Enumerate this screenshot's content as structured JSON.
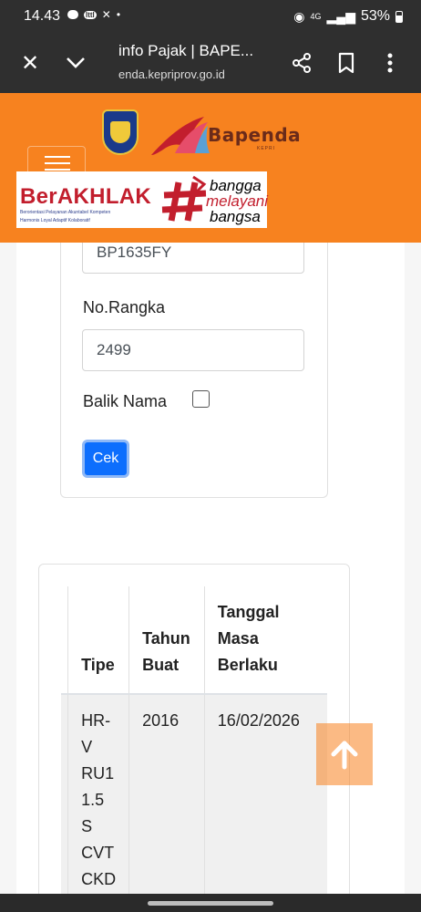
{
  "status_bar": {
    "time": "14.43",
    "notification_badge": "Ittl",
    "battery_percent": "53%",
    "network": "4G"
  },
  "browser": {
    "page_title": "info Pajak | BAPE...",
    "url": "enda.kepriprov.go.id"
  },
  "header": {
    "brand_name": "Bapenda",
    "brand_subtitle": "KEPRI",
    "campaign": {
      "title": "BerAKHLAK",
      "tagline_line1": "Berorientasi Pelayanan Akuntabel Kompeten",
      "tagline_line2": "Harmonis Loyal Adaptif Kolaboratif",
      "slogan_line1": "bangga",
      "slogan_line2": "melayani",
      "slogan_line3": "bangsa"
    }
  },
  "form": {
    "plate_value": "BP1635FY",
    "rangka_label": "No.Rangka",
    "rangka_value": "2499",
    "balik_nama_label": "Balik Nama",
    "balik_nama_checked": false,
    "submit_label": "Cek"
  },
  "result_table": {
    "headers": {
      "tipe_line1": "Tipe",
      "tahun_line1": "Tahun",
      "tahun_line2": "Buat",
      "tanggal_line1": "Tanggal",
      "tanggal_line2": "Masa",
      "tanggal_line3": "Berlaku"
    },
    "rows": [
      {
        "tipe_lines": [
          "HR-",
          "V",
          "RU1",
          "1.5",
          "S",
          "CVT",
          "CKD"
        ],
        "tahun": "2016",
        "tanggal": "16/02/2026"
      }
    ]
  },
  "colors": {
    "header_orange": "#f7821f",
    "button_blue": "#0d6efd",
    "berakhlak_red": "#c21e2d"
  },
  "icons": [
    "close-icon",
    "chevron-down-icon",
    "share-icon",
    "bookmark-icon",
    "more-vert-icon",
    "arrow-up-icon",
    "hamburger-icon"
  ]
}
